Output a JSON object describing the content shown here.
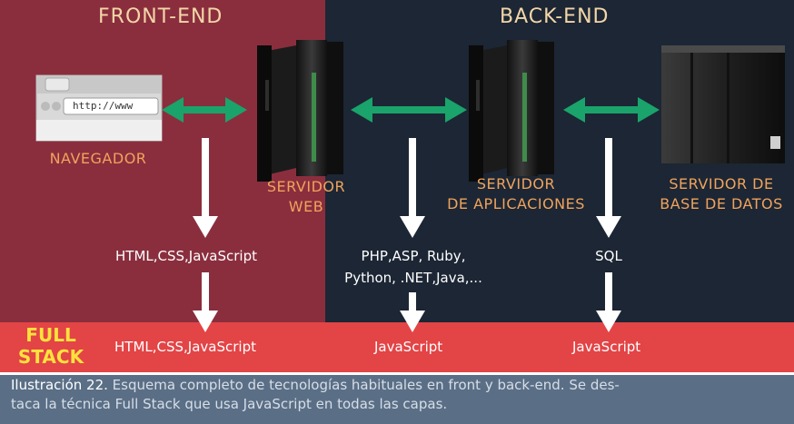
{
  "sections": {
    "front_end": "FRONT-END",
    "back_end": "BACK-END",
    "full_stack_line1": "FULL",
    "full_stack_line2": "STACK"
  },
  "nodes": {
    "browser": {
      "label": "NAVEGADOR",
      "address_text": "http://www"
    },
    "web_server": {
      "line1": "SERVIDOR",
      "line2": "WEB"
    },
    "app_server": {
      "line1": "SERVIDOR",
      "line2": "DE APLICACIONES"
    },
    "db_server": {
      "line1": "SERVIDOR DE",
      "line2": "BASE DE DATOS"
    }
  },
  "technologies": {
    "front": "HTML,CSS,JavaScript",
    "app_line1": "PHP,ASP, Ruby,",
    "app_line2": "Python, .NET,Java,...",
    "db": "SQL"
  },
  "full_stack": {
    "front": "HTML,CSS,JavaScript",
    "app": "JavaScript",
    "db": "JavaScript"
  },
  "caption": {
    "label": "Ilustración 22.",
    "line1": "Esquema completo de tecnologías habituales en front y back-end. Se des-",
    "line2": "taca la técnica Full Stack que usa JavaScript en todas las capas."
  },
  "colors": {
    "front_bg": "#8a2e3e",
    "back_bg": "#1c2634",
    "band_bg": "#e34446",
    "caption_bg": "#5a6f86",
    "arrow_green": "#1aa36b",
    "label_orange": "#f0a35c"
  }
}
